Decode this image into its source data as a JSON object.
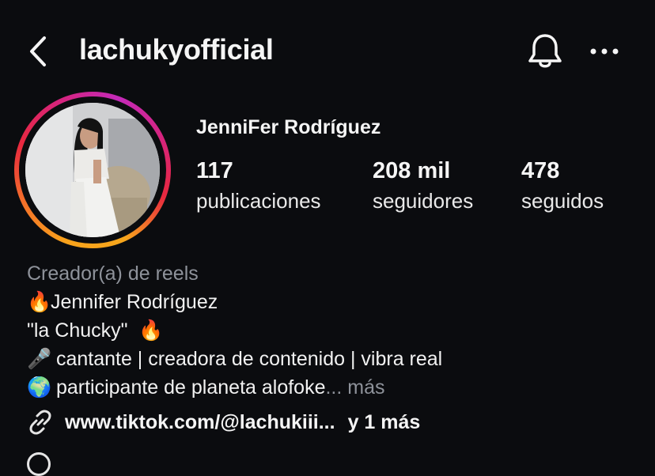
{
  "header": {
    "username": "lachukyofficial",
    "back_icon": "chevron-left-icon",
    "bell_icon": "bell-icon",
    "more_icon": "more-horizontal-icon"
  },
  "profile": {
    "full_name": "JenniFer Rodríguez",
    "avatar_ring_colors": [
      "#f9a31b",
      "#e8283f",
      "#c42ab9"
    ]
  },
  "stats": [
    {
      "value": "117",
      "label": "publicaciones"
    },
    {
      "value": "208 mil",
      "label": "seguidores"
    },
    {
      "value": "478",
      "label": "seguidos"
    }
  ],
  "bio": {
    "category": "Creador(a) de reels",
    "lines": [
      {
        "emoji": "🔥",
        "text": "Jennifer Rodríguez"
      },
      {
        "text": "\"la Chucky\" ",
        "emoji_after": "🔥"
      },
      {
        "emoji": "🎤",
        "text": " cantante | creadora de contenido | vibra real"
      },
      {
        "emoji": "🌍",
        "text": " participante de planeta alofoke",
        "ellipsis": "...",
        "more": " más"
      }
    ]
  },
  "link": {
    "icon": "link-icon",
    "url": "www.tiktok.com/@lachukiii...",
    "extra": "y 1 más"
  }
}
